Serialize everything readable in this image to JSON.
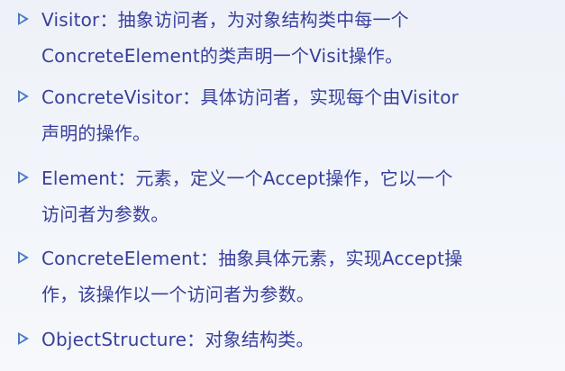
{
  "bullets": [
    {
      "text": "Visitor：抽象访问者，为对象结构类中每一个\nConcreteElement的类声明一个Visit操作。"
    },
    {
      "text": "ConcreteVisitor：具体访问者，实现每个由Visitor\n声明的操作。"
    },
    {
      "text": "Element：元素，定义一个Accept操作，它以一个\n访问者为参数。"
    },
    {
      "text": "ConcreteElement：抽象具体元素，实现Accept操\n作，该操作以一个访问者为参数。"
    },
    {
      "text": "ObjectStructure：对象结构类。"
    }
  ],
  "colors": {
    "text": "#383f9c",
    "bullet": "#4a79c8",
    "background": "#eef2f8"
  },
  "icons": {
    "bullet": "triangle-bullet-icon"
  }
}
